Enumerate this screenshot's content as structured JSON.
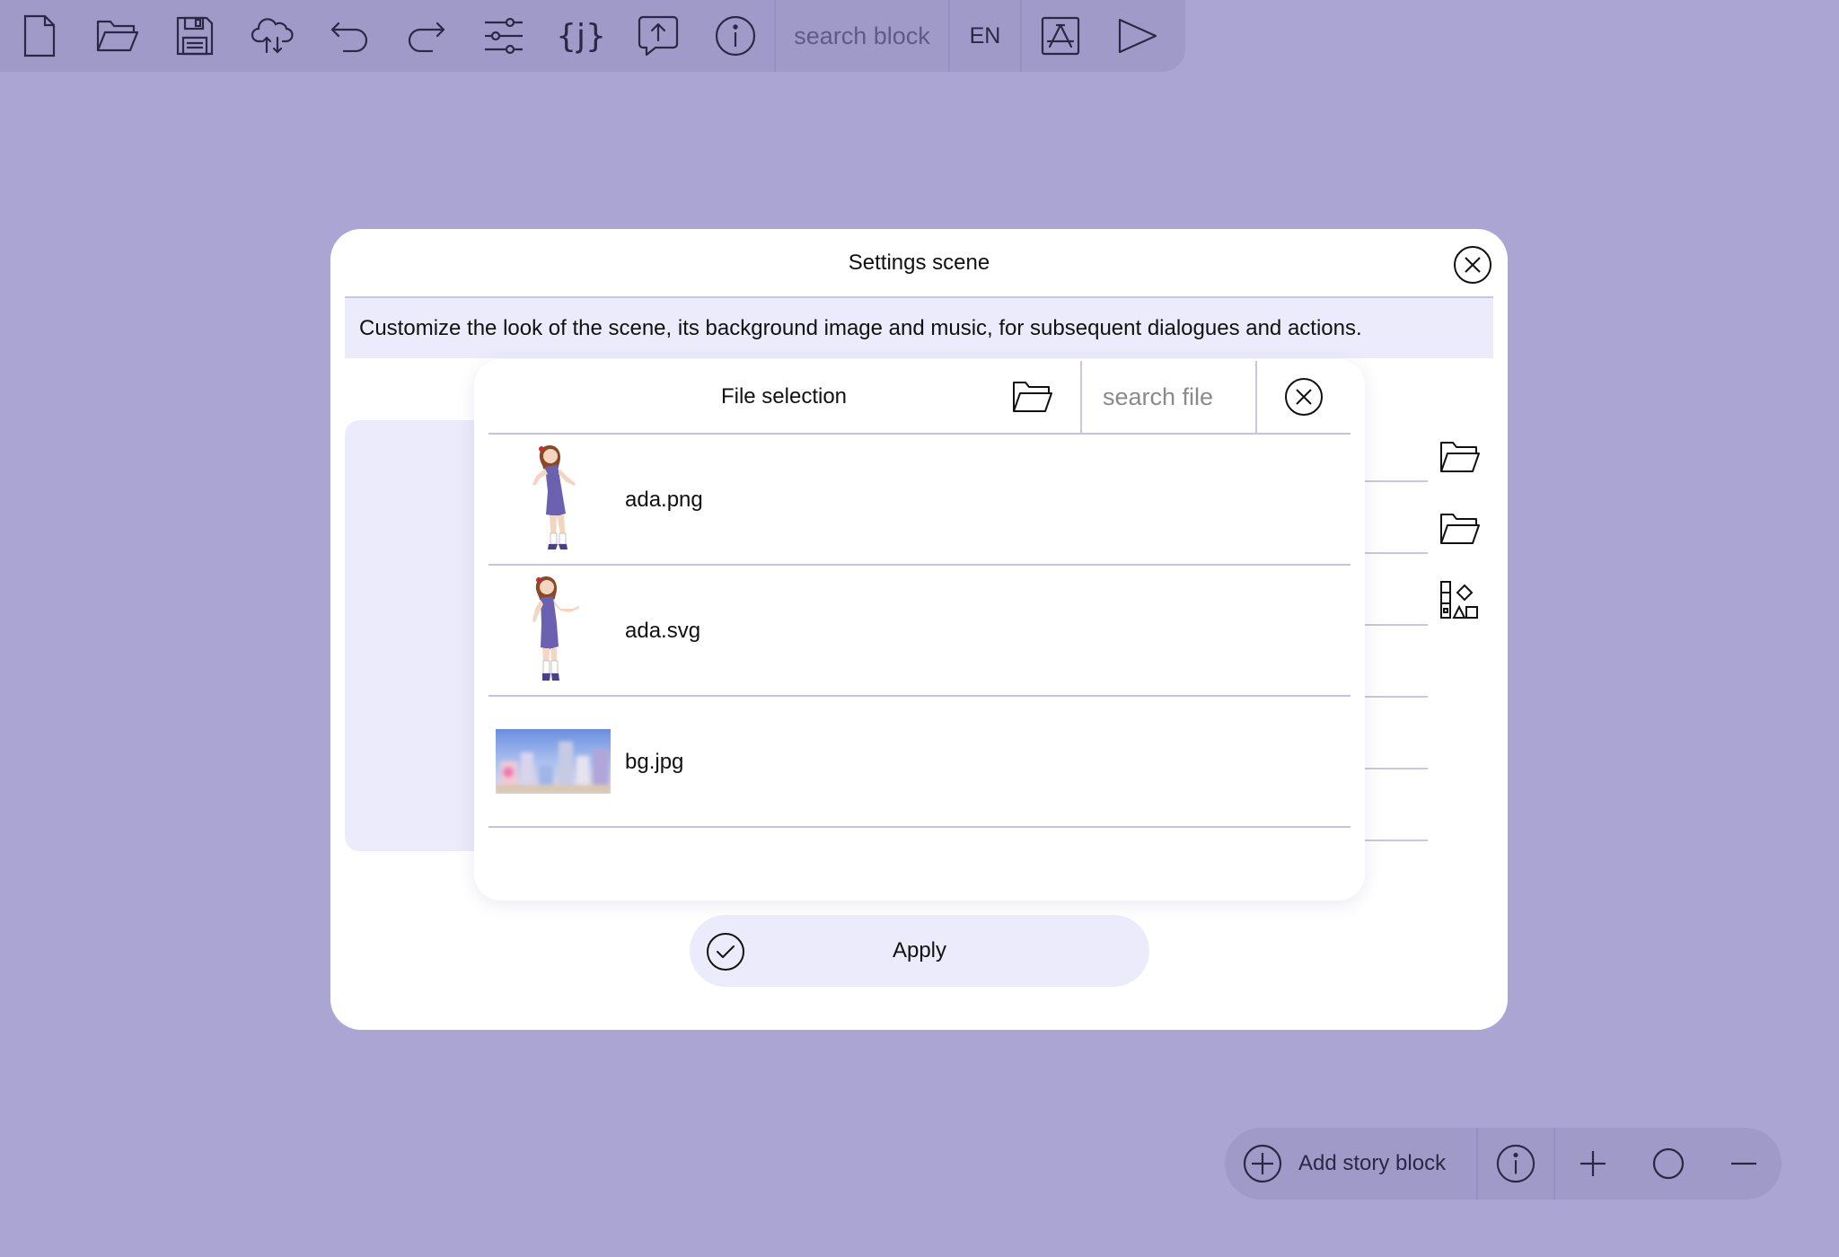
{
  "toolbar": {
    "icons": [
      "new-file-icon",
      "open-folder-icon",
      "save-icon",
      "cloud-sync-icon",
      "undo-icon",
      "redo-icon",
      "sliders-icon",
      "json-braces-icon",
      "upload-message-icon",
      "info-icon",
      "app-store-icon",
      "play-icon"
    ],
    "search_placeholder": "search block",
    "language": "EN"
  },
  "settings_modal": {
    "title": "Settings scene",
    "description": "Customize the look of the scene, its background image and music, for subsequent dialogues and actions.",
    "side_icons": [
      "folder-icon",
      "folder-icon",
      "shapes-icon"
    ],
    "apply_label": "Apply"
  },
  "file_selection": {
    "title": "File selection",
    "search_placeholder": "search file",
    "files": [
      {
        "name": "ada.png",
        "thumb": "character-thumbnail"
      },
      {
        "name": "ada.svg",
        "thumb": "character-thumbnail"
      },
      {
        "name": "bg.jpg",
        "thumb": "background-thumbnail"
      }
    ]
  },
  "bottom_bar": {
    "add_label": "Add story block",
    "icons": [
      "add-circle-icon",
      "info-icon",
      "zoom-in-icon",
      "zoom-reset-icon",
      "zoom-out-icon"
    ]
  },
  "colors": {
    "background": "#aba5d4",
    "toolbar": "#a09ac9",
    "panel": "#ffffff",
    "highlight": "#ecebfb",
    "icon_stroke": "#2b2747"
  }
}
